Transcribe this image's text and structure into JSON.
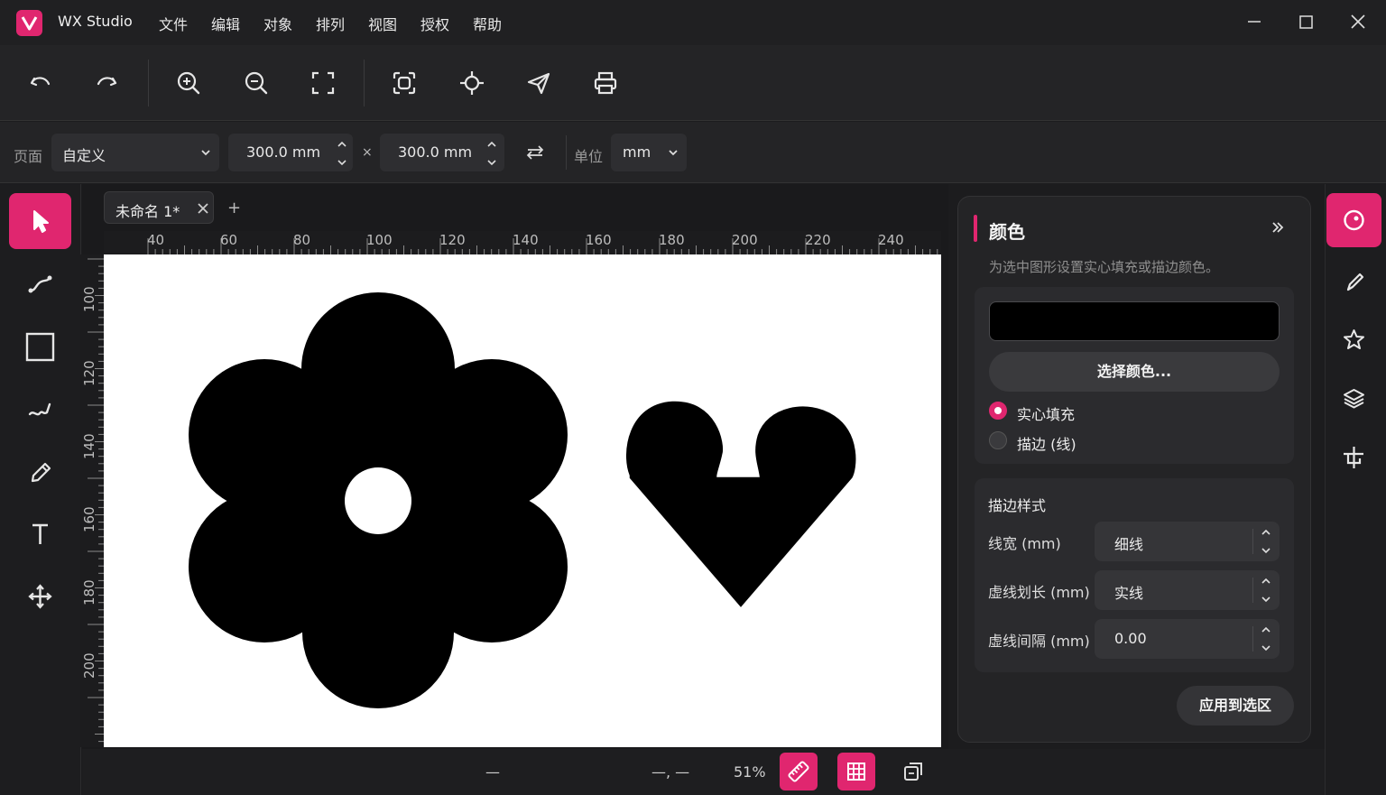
{
  "app": {
    "name": "WX Studio"
  },
  "menu": [
    "文件",
    "编辑",
    "对象",
    "排列",
    "视图",
    "授权",
    "帮助"
  ],
  "toolbar": {
    "buttons": [
      "undo-icon",
      "redo-icon",
      "zoom-in-icon",
      "zoom-out-icon",
      "fit-page-icon",
      "fit-selection-icon",
      "center-icon",
      "send-icon",
      "print-icon"
    ]
  },
  "page_settings": {
    "page_label": "页面",
    "page_preset": "自定义",
    "width": "300.0 mm",
    "times": "×",
    "height": "300.0 mm",
    "unit_label": "单位",
    "unit": "mm"
  },
  "document": {
    "tab_label": "未命名 1*",
    "add_tab": "+",
    "h_ruler": [
      "40",
      "60",
      "80",
      "100",
      "120",
      "140",
      "160",
      "180",
      "200",
      "220",
      "240"
    ],
    "v_ruler": [
      "100",
      "120",
      "140",
      "160",
      "180",
      "200"
    ]
  },
  "status": {
    "left": "—",
    "coords": "—, —",
    "zoom": "51%"
  },
  "panel": {
    "title": "颜色",
    "description": "为选中图形设置实心填充或描边颜色。",
    "pick_color": "选择颜色...",
    "fill_label": "实心填充",
    "stroke_label": "描边 (线)",
    "fill_selected": true,
    "stroke_section_title": "描边样式",
    "line_width_label": "线宽 (mm)",
    "line_width_value": "细线",
    "dash_length_label": "虚线划长 (mm)",
    "dash_length_value": "实线",
    "dash_gap_label": "虚线间隔 (mm)",
    "dash_gap_value": "0.00",
    "apply_button": "应用到选区",
    "swatch_color": "#000000"
  },
  "colors": {
    "accent": "#e0266f"
  }
}
